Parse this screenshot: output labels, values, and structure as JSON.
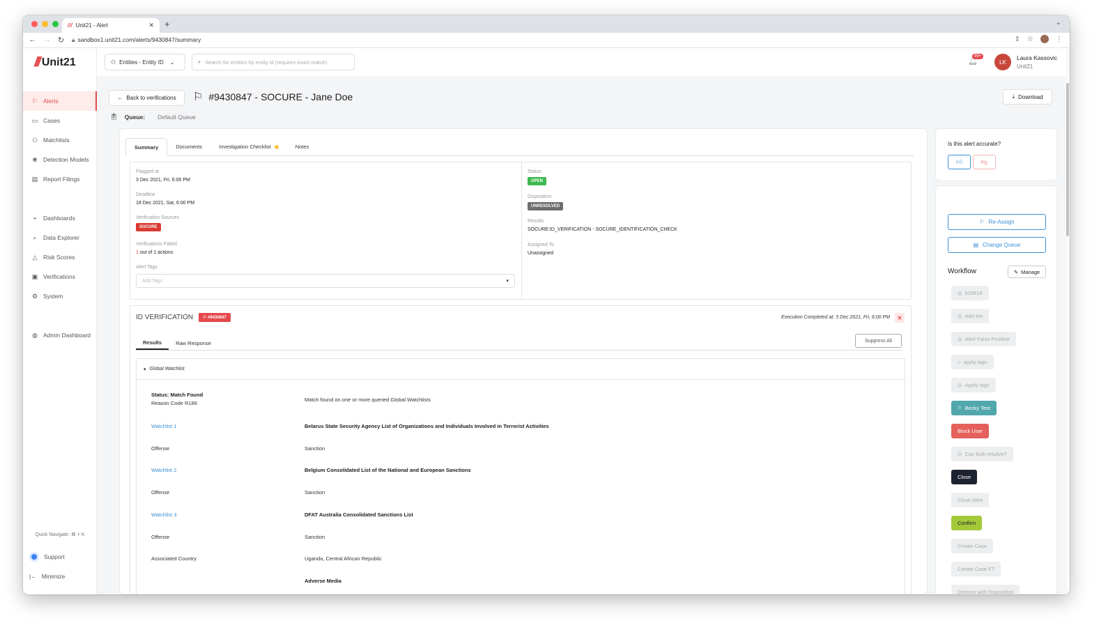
{
  "browser": {
    "tab_title": "Unit21 - Alert",
    "url": "sandbox1.unit21.com/alerts/9430847/summary"
  },
  "sidebar": {
    "logo": "Unit21",
    "items": [
      {
        "label": "Alerts",
        "icon": "flag-icon",
        "active": true
      },
      {
        "label": "Cases",
        "icon": "briefcase-icon"
      },
      {
        "label": "Matchlists",
        "icon": "user-plus-icon"
      },
      {
        "label": "Detection Models",
        "icon": "brain-icon"
      },
      {
        "label": "Report Filings",
        "icon": "file-icon"
      },
      {
        "label": "Dashboards",
        "icon": "chart-icon"
      },
      {
        "label": "Data Explorer",
        "icon": "search-table-icon"
      },
      {
        "label": "Risk Scores",
        "icon": "warning-icon"
      },
      {
        "label": "Verifications",
        "icon": "id-card-icon"
      },
      {
        "label": "System",
        "icon": "gear-icon"
      },
      {
        "label": "Admin Dashboard",
        "icon": "globe-icon"
      }
    ],
    "quick_navigate": "Quick Navigate: ⌘ + K",
    "support": "Support",
    "minimize": "Minimize"
  },
  "header": {
    "entity_select": "Entities - Entity ID",
    "search_placeholder": "Search for entities by entity id (requires exact match)",
    "notif_count": "99+",
    "user_initials": "LK",
    "user_name": "Laura Kassovic",
    "user_org": "Unit21"
  },
  "alert": {
    "back_label": "Back to verifications",
    "title": "#9430847 - SOCURE - Jane Doe",
    "queue_label": "Queue:",
    "queue_value": "Default Queue",
    "download": "Download"
  },
  "tabs": [
    {
      "label": "Summary",
      "active": true
    },
    {
      "label": "Documents"
    },
    {
      "label": "Investigation Checklist",
      "dot": true
    },
    {
      "label": "Notes"
    }
  ],
  "summary": {
    "flagged_at_label": "Flagged at",
    "flagged_at": "3 Dec 2021, Fri, 6:00 PM",
    "deadline_label": "Deadline",
    "deadline": "18 Dec 2021, Sat, 6:00 PM",
    "sources_label": "Verification Sources",
    "source": "SOCURE",
    "failed_label": "Verifications Failed",
    "failed_count": "1",
    "failed_rest": " out of 1 actions",
    "tags_label": "Alert Tags",
    "tags_placeholder": "Add Tags",
    "status_label": "Status",
    "status": "OPEN",
    "disposition_label": "Disposition",
    "disposition": "UNRESOLVED",
    "results_label": "Results",
    "results": "SOCURE:ID_VERIFICATION - SOCURE_IDENTIFICATION_CHECK",
    "assigned_label": "Assigned To",
    "assigned": "Unassigned",
    "colors": {
      "open": "#3fb950",
      "unresolved": "#6e6e6e",
      "socure": "#d93a32"
    }
  },
  "id_verification": {
    "title": "ID VERIFICATION",
    "badge": "#9430847",
    "execution": "Execution Completed at: 3 Dec 2021, Fri, 6:00 PM",
    "subtabs": [
      "Results",
      "Raw Response"
    ],
    "suppress_all": "Suppress All",
    "section": "Global Watchlist",
    "status_title": "Status: Match Found",
    "reason_code": "Reason Code R186",
    "status_desc": "Match found on one or more queried Global Watchlists",
    "rows": [
      {
        "k": "Watchlist 1",
        "v": "Belarus State Security Agency List of Organizations and Individuals Involved in Terrorist Activities",
        "link": true,
        "bold": true
      },
      {
        "k": "Offense",
        "v": "Sanction"
      },
      {
        "k": "Watchlist 2",
        "v": "Belgium Consolidated List of the National and European Sanctions",
        "link": true,
        "bold": true
      },
      {
        "k": "Offense",
        "v": "Sanction"
      },
      {
        "k": "Watchlist 3",
        "v": "DFAT Australia Consolidated Sanctions List",
        "link": true,
        "bold": true
      },
      {
        "k": "Offense",
        "v": "Sanction"
      },
      {
        "k": "Associated Country",
        "v": "Uganda, Central African Republic"
      },
      {
        "k": "",
        "v": "Adverse Media",
        "bold": true
      }
    ]
  },
  "right": {
    "accurate_q": "Is this alert accurate?",
    "reassign": "Re-Assign",
    "change_queue": "Change Queue",
    "workflow": "Workflow",
    "manage": "Manage",
    "buttons": [
      {
        "label": "619619",
        "style": "dis",
        "icon": true
      },
      {
        "label": "Add em",
        "style": "dis",
        "icon": true
      },
      {
        "label": "Alert False Positive",
        "style": "dis",
        "icon": true
      },
      {
        "label": "apply tags",
        "style": "dis",
        "icon": true,
        "tag": true
      },
      {
        "label": "Apply tags",
        "style": "dis",
        "icon": true
      },
      {
        "label": "Becky Test",
        "style": "teal",
        "icon": true,
        "flag": true
      },
      {
        "label": "Block User",
        "style": "red"
      },
      {
        "label": "Can bulk resolve?",
        "style": "dis",
        "icon": true
      },
      {
        "label": "Close",
        "style": "dark"
      },
      {
        "label": "Close Alert",
        "style": "dis"
      },
      {
        "label": "Confirm",
        "style": "green"
      },
      {
        "label": "Create Case",
        "style": "dis"
      },
      {
        "label": "Create Case FT",
        "style": "dis"
      },
      {
        "label": "Dismiss with Disposition",
        "style": "dis"
      }
    ],
    "colors": {
      "teal": "#52a7ad",
      "red": "#e5605a",
      "dark": "#1f2330",
      "green": "#a3c93a"
    }
  }
}
